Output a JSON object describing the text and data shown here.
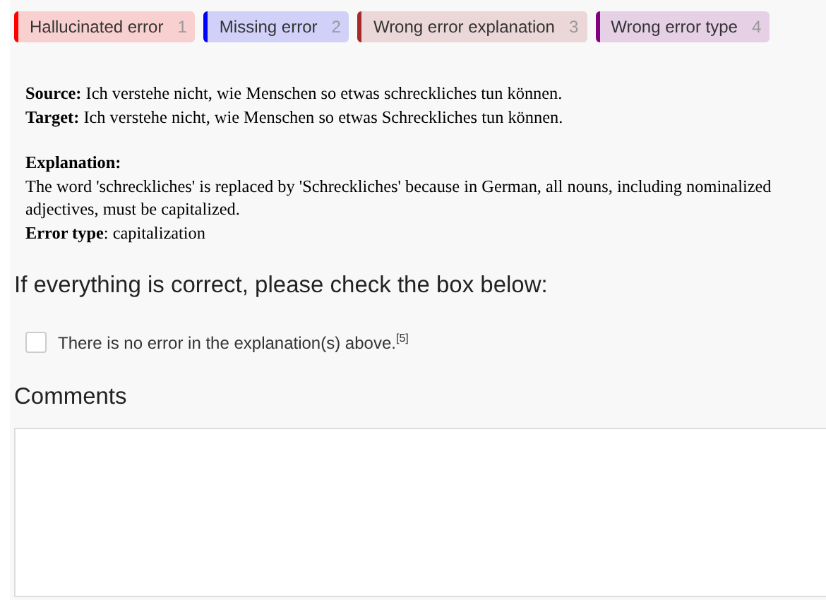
{
  "labels": [
    {
      "text": "Hallucinated error",
      "hotkey": "1",
      "color": "#ff0000"
    },
    {
      "text": "Missing error",
      "hotkey": "2",
      "color": "#0000ff"
    },
    {
      "text": "Wrong error explanation",
      "hotkey": "3",
      "color": "#a52a2a"
    },
    {
      "text": "Wrong error type",
      "hotkey": "4",
      "color": "#800080"
    }
  ],
  "source": {
    "label": "Source:",
    "text": "Ich verstehe nicht, wie Menschen so etwas schreckliches tun können."
  },
  "target": {
    "label": "Target:",
    "text": "Ich verstehe nicht, wie Menschen so etwas Schreckliches tun können."
  },
  "explanation": {
    "label": "Explanation:",
    "text": "The word 'schreckliches' is replaced by 'Schreckliches' because in German, all nouns, including nominalized adjectives, must be capitalized."
  },
  "error_type": "**Error type**: capitalization",
  "check_heading": "If everything is correct, please check the box below:",
  "checkbox": {
    "label": "There is no error in the explanation(s) above.$^{[5]}$",
    "checked": false
  },
  "comments": {
    "heading": "Comments"
  }
}
